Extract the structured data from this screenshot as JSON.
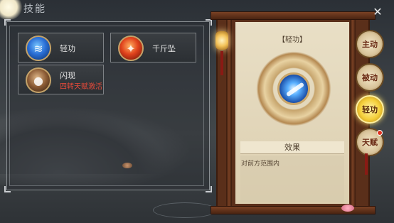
{
  "header": {
    "title": "技能"
  },
  "skills": [
    {
      "name": "轻功",
      "icon": "blue-wind-icon"
    },
    {
      "name": "千斤坠",
      "icon": "red-fall-icon"
    },
    {
      "name": "闪现",
      "icon": "blink-icon",
      "sub": "四转天赋激活"
    }
  ],
  "detail": {
    "heading": "【轻功】",
    "effect_title": "效果",
    "effect_text": "对前方范围内"
  },
  "tabs": [
    {
      "label": "主动"
    },
    {
      "label": "被动"
    },
    {
      "label": "轻功",
      "active": true
    },
    {
      "label": "天赋",
      "badge": true
    }
  ],
  "close_glyph": "✕",
  "colors": {
    "accent": "#f4cf3a",
    "warning": "#e64a3a"
  }
}
